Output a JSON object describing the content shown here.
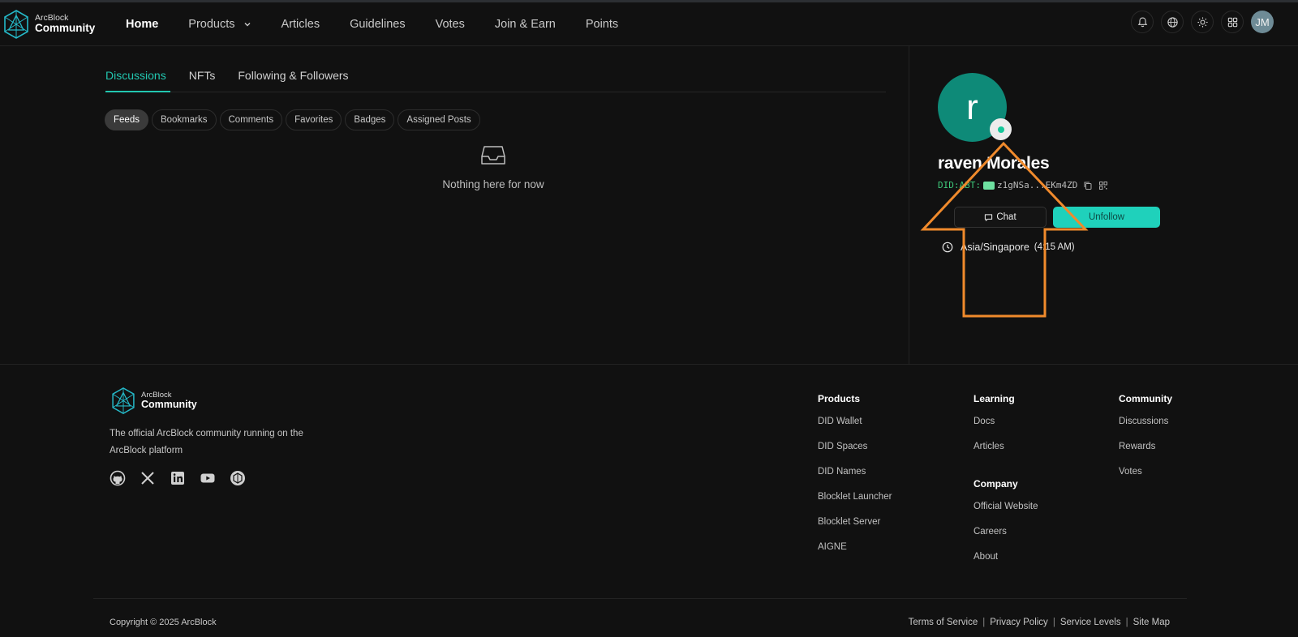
{
  "brand": {
    "line1": "ArcBlock",
    "line2": "Community"
  },
  "nav": {
    "items": [
      {
        "label": "Home"
      },
      {
        "label": "Products"
      },
      {
        "label": "Articles"
      },
      {
        "label": "Guidelines"
      },
      {
        "label": "Votes"
      },
      {
        "label": "Join & Earn"
      },
      {
        "label": "Points"
      }
    ],
    "active": "Home"
  },
  "header": {
    "icons": [
      "bell-icon",
      "globe-icon",
      "sun-icon",
      "apps-grid-icon"
    ],
    "user_initials": "JM"
  },
  "tabs": [
    "Discussions",
    "NFTs",
    "Following & Followers"
  ],
  "active_tab": "Discussions",
  "filters": [
    "Feeds",
    "Bookmarks",
    "Comments",
    "Favorites",
    "Badges",
    "Assigned Posts"
  ],
  "active_filter": "Feeds",
  "empty_state": {
    "icon": "inbox-icon",
    "text": "Nothing here for now"
  },
  "profile": {
    "avatar_letter": "r",
    "avatar_color": "#0e8a78",
    "status": "online",
    "name": "raven Morales",
    "did_prefix": "DID:ABT:",
    "did_value": "z1gNSa...EKm4ZD",
    "chat_label": "Chat",
    "unfollow_label": "Unfollow",
    "timezone": "Asia/Singapore",
    "local_time": "(4:15 AM)"
  },
  "footer": {
    "brand": {
      "line1": "ArcBlock",
      "line2": "Community"
    },
    "description": "The official ArcBlock community running on the ArcBlock platform",
    "social_icons": [
      "github-icon",
      "x-icon",
      "linkedin-icon",
      "youtube-icon",
      "arcblock-icon"
    ],
    "columns": {
      "products": {
        "title": "Products",
        "links": [
          "DID Wallet",
          "DID Spaces",
          "DID Names",
          "Blocklet Launcher",
          "Blocklet Server",
          "AIGNE"
        ]
      },
      "learning": {
        "title": "Learning",
        "links": [
          "Docs",
          "Articles"
        ]
      },
      "company": {
        "title": "Company",
        "links": [
          "Official Website",
          "Careers",
          "About"
        ]
      },
      "community": {
        "title": "Community",
        "links": [
          "Discussions",
          "Rewards",
          "Votes"
        ]
      }
    },
    "copyright": "Copyright © 2025 ArcBlock",
    "legal": [
      "Terms of Service",
      "Privacy Policy",
      "Service Levels",
      "Site Map"
    ]
  },
  "colors": {
    "accent": "#22c7b0",
    "unfollow_bg": "#1fd1bb",
    "annotation_arrow": "#f08a2c",
    "background": "#111111"
  }
}
